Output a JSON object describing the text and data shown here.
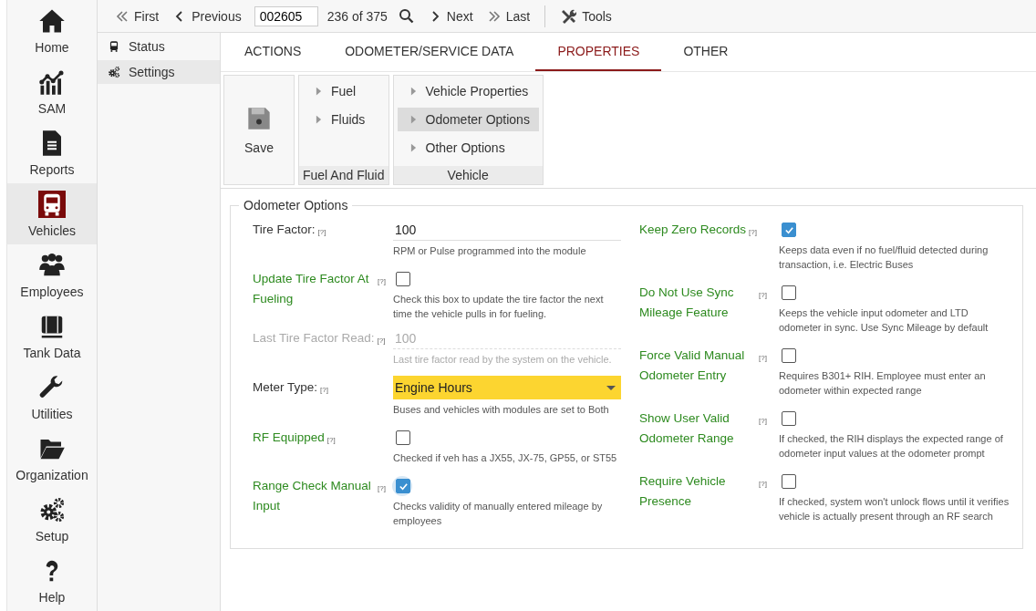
{
  "nav": [
    {
      "label": "Home",
      "kind": "home",
      "selected": false
    },
    {
      "label": "SAM",
      "kind": "chart",
      "selected": false
    },
    {
      "label": "Reports",
      "kind": "document",
      "selected": false
    },
    {
      "label": "Vehicles",
      "kind": "bus",
      "selected": true
    },
    {
      "label": "Employees",
      "kind": "people",
      "selected": false
    },
    {
      "label": "Tank Data",
      "kind": "tank",
      "selected": false
    },
    {
      "label": "Utilities",
      "kind": "wrench",
      "selected": false
    },
    {
      "label": "Organization",
      "kind": "folder",
      "selected": false
    },
    {
      "label": "Setup",
      "kind": "gears",
      "selected": false
    },
    {
      "label": "Help",
      "kind": "help",
      "selected": false
    }
  ],
  "toolbar": {
    "first": "First",
    "previous": "Previous",
    "record": "002605",
    "position": "236 of 375",
    "next": "Next",
    "last": "Last",
    "tools": "Tools"
  },
  "side_menu": [
    {
      "label": "Status",
      "kind": "bus",
      "selected": false
    },
    {
      "label": "Settings",
      "kind": "gears",
      "selected": true
    }
  ],
  "tabs": [
    {
      "label": "ACTIONS",
      "selected": false
    },
    {
      "label": "ODOMETER/SERVICE DATA",
      "selected": false
    },
    {
      "label": "PROPERTIES",
      "selected": true
    },
    {
      "label": "OTHER",
      "selected": false
    }
  ],
  "ribbon": {
    "save": "Save",
    "groups": [
      {
        "title": "Fuel And Fluid",
        "items": [
          {
            "label": "Fuel",
            "selected": false
          },
          {
            "label": "Fluids",
            "selected": false
          }
        ]
      },
      {
        "title": "Vehicle",
        "items": [
          {
            "label": "Vehicle Properties",
            "selected": false
          },
          {
            "label": "Odometer Options",
            "selected": true
          },
          {
            "label": "Other Options",
            "selected": false
          }
        ]
      }
    ]
  },
  "form": {
    "legend": "Odometer Options",
    "columns": [
      [
        {
          "kind": "text",
          "label": "Tire Factor:",
          "help": "[?]",
          "value": "100",
          "description": "RPM or Pulse programmed into the module",
          "disabled": false
        },
        {
          "kind": "checkbox",
          "label": "Update Tire Factor At Fueling",
          "help": "[?]",
          "checked": false,
          "focused": false,
          "description": "Check this box to update the tire factor the next time the vehicle pulls in for fueling."
        },
        {
          "kind": "text",
          "label": "Last Tire Factor Read:",
          "help": "[?]",
          "value": "100",
          "description": "Last tire factor read by the system on the vehicle.",
          "disabled": true
        },
        {
          "kind": "select",
          "label": "Meter Type:",
          "help": "[?]",
          "value": "Engine Hours",
          "description": "Buses and vehicles with modules are set to Both"
        },
        {
          "kind": "checkbox",
          "label": "RF Equipped",
          "help": "[?]",
          "checked": false,
          "focused": false,
          "description": "Checked if veh has a JX55, JX-75, GP55, or ST55"
        },
        {
          "kind": "checkbox",
          "label": "Range Check Manual Input",
          "help": "[?]",
          "checked": true,
          "focused": true,
          "description": "Checks validity of manually entered mileage by employees"
        }
      ],
      [
        {
          "kind": "checkbox",
          "label": "Keep Zero Records",
          "help": "[?]",
          "checked": true,
          "focused": false,
          "description": "Keeps data even if no fuel/fluid detected during transaction, i.e. Electric Buses"
        },
        {
          "kind": "checkbox",
          "label": "Do Not Use Sync Mileage Feature",
          "help": "[?]",
          "checked": false,
          "focused": false,
          "description": "Keeps the vehicle input odometer and LTD odometer in sync. Use Sync Mileage by default"
        },
        {
          "kind": "checkbox",
          "label": "Force Valid Manual Odometer Entry",
          "help": "[?]",
          "checked": false,
          "focused": false,
          "description": "Requires B301+ RIH. Employee must enter an odometer within expected range"
        },
        {
          "kind": "checkbox",
          "label": "Show User Valid Odometer Range",
          "help": "[?]",
          "checked": false,
          "focused": false,
          "description": "If checked, the RIH displays the expected range of odometer input values at the odometer prompt"
        },
        {
          "kind": "checkbox",
          "label": "Require Vehicle Presence",
          "help": "[?]",
          "checked": false,
          "focused": false,
          "description": "If checked, system won't unlock flows until it verifies vehicle is actually present through an RF search"
        }
      ]
    ]
  }
}
